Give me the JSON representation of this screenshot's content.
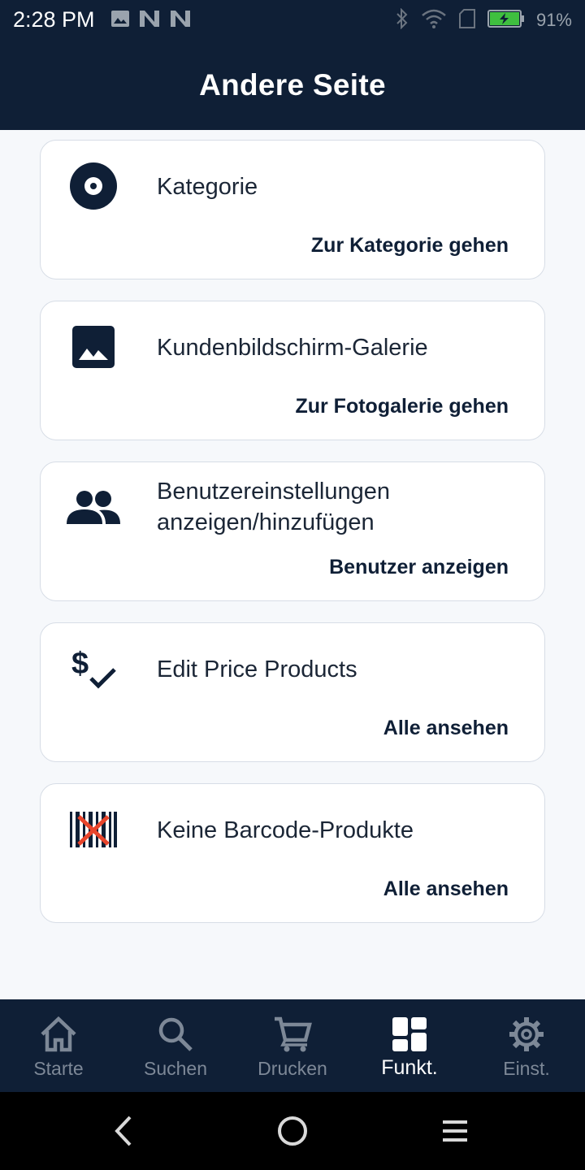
{
  "status_bar": {
    "time": "2:28 PM",
    "battery_percent": "91%",
    "battery_level": 0.91,
    "icons_left": [
      "image-icon",
      "n-notification-icon",
      "n-notification-icon"
    ],
    "icons_right": [
      "bluetooth-icon",
      "wifi-icon",
      "sim-icon",
      "battery-charging-icon"
    ]
  },
  "app_bar": {
    "title": "Andere Seite"
  },
  "cards": [
    {
      "icon": "category-target-icon",
      "title": "Kategorie",
      "action": "Zur Kategorie gehen"
    },
    {
      "icon": "image-gallery-icon",
      "title": "Kundenbildschirm-Galerie",
      "action": "Zur Fotogalerie gehen"
    },
    {
      "icon": "users-icon",
      "title": "Benutzereinstellungen anzeigen/hinzufügen",
      "action": "Benutzer anzeigen"
    },
    {
      "icon": "price-check-icon",
      "title": "Edit Price Products",
      "action": "Alle ansehen"
    },
    {
      "icon": "no-barcode-icon",
      "title": "Keine Barcode-Produkte",
      "action": "Alle ansehen"
    }
  ],
  "bottom_nav": {
    "items": [
      {
        "icon": "home-icon",
        "label": "Starte",
        "active": false
      },
      {
        "icon": "search-icon",
        "label": "Suchen",
        "active": false
      },
      {
        "icon": "cart-icon",
        "label": "Drucken",
        "active": false
      },
      {
        "icon": "dashboard-icon",
        "label": "Funkt.",
        "active": true
      },
      {
        "icon": "gear-icon",
        "label": "Einst.",
        "active": false
      }
    ]
  },
  "system_nav": {
    "buttons": [
      "back-icon",
      "home-circle-icon",
      "menu-icon"
    ]
  },
  "colors": {
    "primary": "#0f1f36",
    "background": "#f6f8fb",
    "card_border": "#d7dde6",
    "nav_inactive": "#7d8897",
    "barcode_cross": "#e8452c",
    "battery_fill": "#3fbf3f"
  }
}
